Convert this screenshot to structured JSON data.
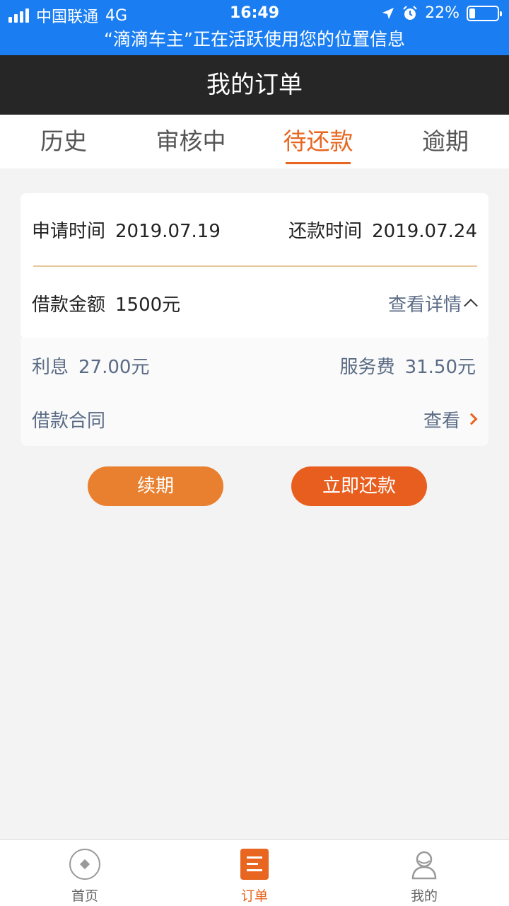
{
  "status_bar": {
    "carrier": "中国联通",
    "network": "4G",
    "time": "16:49",
    "battery": "22%",
    "battery_level": 0.22,
    "location_banner": "“滴滴车主”正在活跃使用您的位置信息"
  },
  "nav": {
    "title": "我的订单"
  },
  "tabs": [
    {
      "label": "历史"
    },
    {
      "label": "审核中"
    },
    {
      "label": "待还款",
      "active": true
    },
    {
      "label": "逾期"
    }
  ],
  "order": {
    "apply_label": "申请时间",
    "apply_date": "2019.07.19",
    "repay_label": "还款时间",
    "repay_date": "2019.07.24",
    "amount_label": "借款金额",
    "amount": "1500元",
    "detail_link": "查看详情",
    "interest_label": "利息",
    "interest": "27.00元",
    "fee_label": "服务费",
    "fee": "31.50元",
    "contract_label": "借款合同",
    "contract_link": "查看"
  },
  "actions": {
    "renew": "续期",
    "repay_now": "立即还款"
  },
  "tabbar": [
    {
      "label": "首页",
      "icon": "home-icon"
    },
    {
      "label": "订单",
      "icon": "order-icon",
      "active": true
    },
    {
      "label": "我的",
      "icon": "profile-icon"
    }
  ],
  "colors": {
    "status_blue": "#1a7ef2",
    "accent_orange": "#e8661f",
    "nav_dark": "#262626"
  }
}
